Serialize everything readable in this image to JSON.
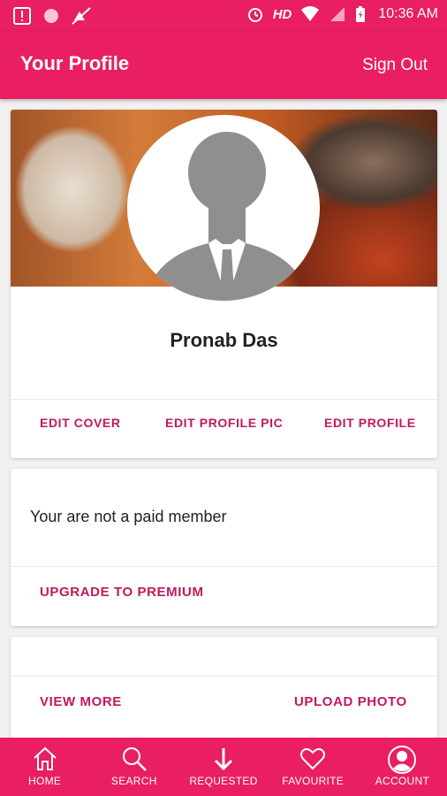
{
  "status_bar": {
    "network": "HD",
    "time": "10:36 AM"
  },
  "app_bar": {
    "title": "Your Profile",
    "sign_out": "Sign Out"
  },
  "profile": {
    "name": "Pronab Das",
    "actions": {
      "edit_cover": "EDIT COVER",
      "edit_profile_pic": "EDIT PROFILE PIC",
      "edit_profile": "EDIT PROFILE"
    }
  },
  "membership": {
    "status_text": "Your are not a paid member",
    "upgrade": "UPGRADE TO PREMIUM"
  },
  "photos": {
    "view_more": "VIEW MORE",
    "upload_photo": "UPLOAD PHOTO"
  },
  "bottom_nav": {
    "items": [
      {
        "label": "HOME",
        "icon": "home-icon"
      },
      {
        "label": "SEARCH",
        "icon": "search-icon"
      },
      {
        "label": "REQUESTED",
        "icon": "download-arrow-icon"
      },
      {
        "label": "FAVOURITE",
        "icon": "heart-icon"
      },
      {
        "label": "ACCOUNT",
        "icon": "account-icon"
      }
    ]
  },
  "colors": {
    "primary": "#e91e63",
    "accent_text": "#c2185b"
  }
}
